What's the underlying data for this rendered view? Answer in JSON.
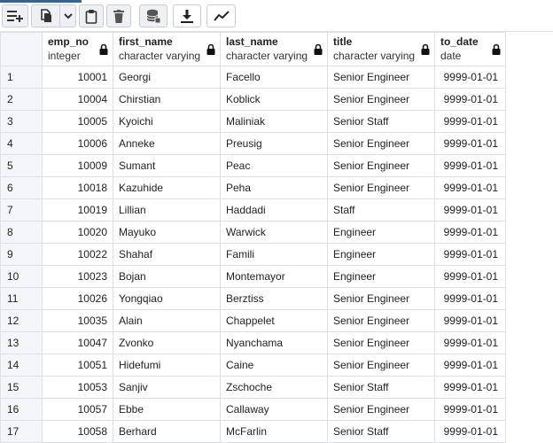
{
  "toolbar": {
    "buttons": [
      {
        "name": "add-row-button",
        "icon": "add-row-icon"
      },
      {
        "name": "copy-button",
        "icon": "copy-icon"
      },
      {
        "name": "copy-options-dropdown",
        "icon": "chevron-down-icon"
      },
      {
        "name": "paste-button",
        "icon": "paste-icon"
      },
      {
        "name": "delete-button",
        "icon": "trash-icon"
      },
      {
        "name": "save-data-button",
        "icon": "database-save-icon"
      },
      {
        "name": "download-button",
        "icon": "download-icon"
      },
      {
        "name": "graph-visualiser-button",
        "icon": "line-chart-icon"
      }
    ]
  },
  "columns": [
    {
      "name": "emp_no",
      "type": "integer"
    },
    {
      "name": "first_name",
      "type": "character varying"
    },
    {
      "name": "last_name",
      "type": "character varying"
    },
    {
      "name": "title",
      "type": "character varying"
    },
    {
      "name": "to_date",
      "type": "date"
    }
  ],
  "rows": [
    {
      "n": "1",
      "emp_no": "10001",
      "first_name": "Georgi",
      "last_name": "Facello",
      "title": "Senior Engineer",
      "to_date": "9999-01-01"
    },
    {
      "n": "2",
      "emp_no": "10004",
      "first_name": "Chirstian",
      "last_name": "Koblick",
      "title": "Senior Engineer",
      "to_date": "9999-01-01"
    },
    {
      "n": "3",
      "emp_no": "10005",
      "first_name": "Kyoichi",
      "last_name": "Maliniak",
      "title": "Senior Staff",
      "to_date": "9999-01-01"
    },
    {
      "n": "4",
      "emp_no": "10006",
      "first_name": "Anneke",
      "last_name": "Preusig",
      "title": "Senior Engineer",
      "to_date": "9999-01-01"
    },
    {
      "n": "5",
      "emp_no": "10009",
      "first_name": "Sumant",
      "last_name": "Peac",
      "title": "Senior Engineer",
      "to_date": "9999-01-01"
    },
    {
      "n": "6",
      "emp_no": "10018",
      "first_name": "Kazuhide",
      "last_name": "Peha",
      "title": "Senior Engineer",
      "to_date": "9999-01-01"
    },
    {
      "n": "7",
      "emp_no": "10019",
      "first_name": "Lillian",
      "last_name": "Haddadi",
      "title": "Staff",
      "to_date": "9999-01-01"
    },
    {
      "n": "8",
      "emp_no": "10020",
      "first_name": "Mayuko",
      "last_name": "Warwick",
      "title": "Engineer",
      "to_date": "9999-01-01"
    },
    {
      "n": "9",
      "emp_no": "10022",
      "first_name": "Shahaf",
      "last_name": "Famili",
      "title": "Engineer",
      "to_date": "9999-01-01"
    },
    {
      "n": "10",
      "emp_no": "10023",
      "first_name": "Bojan",
      "last_name": "Montemayor",
      "title": "Engineer",
      "to_date": "9999-01-01"
    },
    {
      "n": "11",
      "emp_no": "10026",
      "first_name": "Yongqiao",
      "last_name": "Berztiss",
      "title": "Senior Engineer",
      "to_date": "9999-01-01"
    },
    {
      "n": "12",
      "emp_no": "10035",
      "first_name": "Alain",
      "last_name": "Chappelet",
      "title": "Senior Engineer",
      "to_date": "9999-01-01"
    },
    {
      "n": "13",
      "emp_no": "10047",
      "first_name": "Zvonko",
      "last_name": "Nyanchama",
      "title": "Senior Engineer",
      "to_date": "9999-01-01"
    },
    {
      "n": "14",
      "emp_no": "10051",
      "first_name": "Hidefumi",
      "last_name": "Caine",
      "title": "Senior Engineer",
      "to_date": "9999-01-01"
    },
    {
      "n": "15",
      "emp_no": "10053",
      "first_name": "Sanjiv",
      "last_name": "Zschoche",
      "title": "Senior Staff",
      "to_date": "9999-01-01"
    },
    {
      "n": "16",
      "emp_no": "10057",
      "first_name": "Ebbe",
      "last_name": "Callaway",
      "title": "Senior Engineer",
      "to_date": "9999-01-01"
    },
    {
      "n": "17",
      "emp_no": "10058",
      "first_name": "Berhard",
      "last_name": "McFarlin",
      "title": "Senior Staff",
      "to_date": "9999-01-01"
    }
  ],
  "colors": {
    "accent": "#326690",
    "grid_border": "#dde0e6",
    "row_header_bg": "#f3f5f8"
  }
}
